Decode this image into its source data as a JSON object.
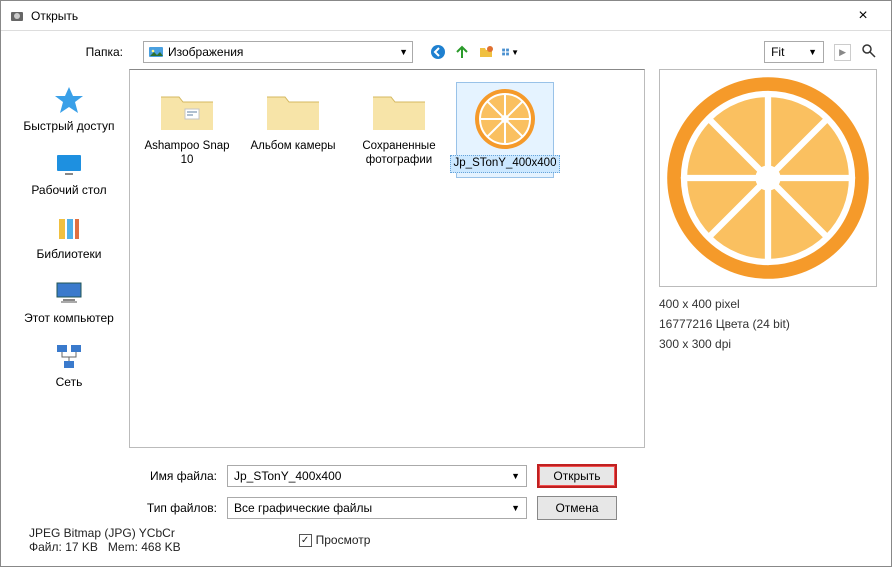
{
  "window": {
    "title": "Открыть"
  },
  "topbar": {
    "folder_label": "Папка:",
    "folder_value": "Изображения",
    "fit_value": "Fit"
  },
  "sidebar": {
    "items": [
      {
        "label": "Быстрый доступ"
      },
      {
        "label": "Рабочий стол"
      },
      {
        "label": "Библиотеки"
      },
      {
        "label": "Этот компьютер"
      },
      {
        "label": "Сеть"
      }
    ]
  },
  "files": [
    {
      "name": "Ashampoo Snap 10",
      "type": "folder"
    },
    {
      "name": "Альбом камеры",
      "type": "folder"
    },
    {
      "name": "Сохраненные фотографии",
      "type": "folder"
    },
    {
      "name": "Jp_STonY_400x400",
      "type": "image",
      "selected": true
    }
  ],
  "inputs": {
    "filename_label": "Имя файла:",
    "filename_value": "Jp_STonY_400x400",
    "filetype_label": "Тип файлов:",
    "filetype_value": "Все графические файлы"
  },
  "buttons": {
    "open": "Открыть",
    "cancel": "Отмена"
  },
  "preview": {
    "dimensions": "400 x 400 pixel",
    "colors": "16777216 Цвета (24 bit)",
    "dpi": "300 x 300 dpi"
  },
  "status": {
    "format": "JPEG Bitmap (JPG) YCbCr",
    "filesize_label": "Файл:",
    "filesize": "17 KB",
    "mem_label": "Mem:",
    "mem": "468 KB",
    "preview_checkbox": "Просмотр"
  }
}
